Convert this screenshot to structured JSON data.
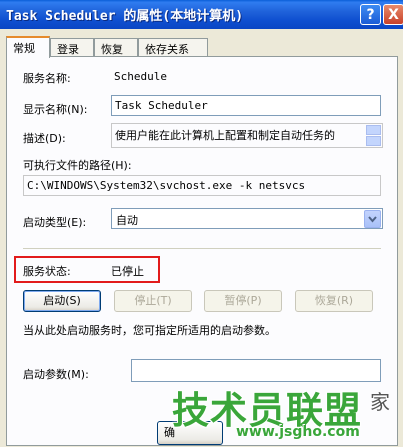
{
  "window": {
    "title": "Task Scheduler 的属性(本地计算机)",
    "help_button": "?",
    "close_button": "X"
  },
  "tabs": [
    {
      "label": "常规",
      "active": true
    },
    {
      "label": "登录",
      "active": false
    },
    {
      "label": "恢复",
      "active": false
    },
    {
      "label": "依存关系",
      "active": false
    }
  ],
  "general": {
    "service_name_label": "服务名称:",
    "service_name": "Schedule",
    "display_name_label": "显示名称(N):",
    "display_name": "Task Scheduler",
    "description_label": "描述(D):",
    "description": "使用户能在此计算机上配置和制定自动任务的",
    "exe_path_label": "可执行文件的路径(H):",
    "exe_path": "C:\\WINDOWS\\System32\\svchost.exe -k netsvcs",
    "startup_type_label": "启动类型(E):",
    "startup_type": "自动",
    "service_status_label": "服务状态:",
    "service_status": "已停止",
    "buttons": {
      "start": "启动(S)",
      "stop": "停止(T)",
      "pause": "暂停(P)",
      "resume": "恢复(R)"
    },
    "hint": "当从此处启动服务时，您可指定所适用的启动参数。",
    "start_params_label": "启动参数(M):",
    "start_params": ""
  },
  "footer": {
    "ok_partial": "确"
  },
  "watermark": {
    "text": "技术员联盟",
    "url": "www.jsgho.com",
    "suffix": "家"
  },
  "colors": {
    "titlebar": "#0a5ed8",
    "highlight_box": "#e21b1b",
    "watermark_green": "#3aa63a"
  }
}
